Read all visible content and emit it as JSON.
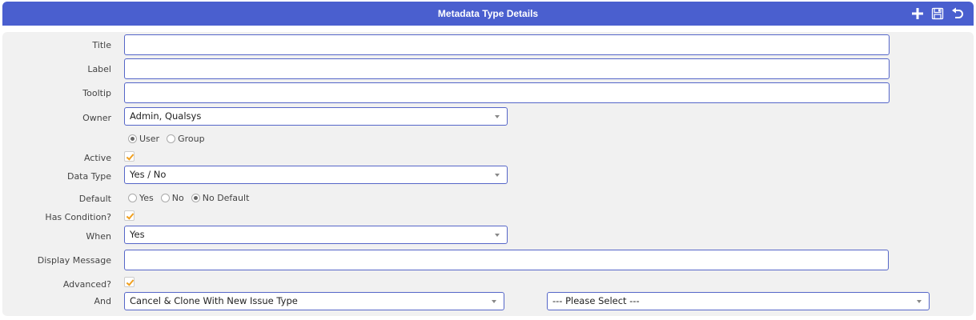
{
  "header": {
    "title": "Metadata Type Details",
    "icons": [
      "add-icon",
      "save-icon",
      "undo-icon"
    ]
  },
  "form": {
    "title": {
      "label": "Title",
      "value": ""
    },
    "label": {
      "label": "Label",
      "value": ""
    },
    "tooltip": {
      "label": "Tooltip",
      "value": ""
    },
    "owner": {
      "label": "Owner",
      "value": "Admin, Qualsys",
      "type_options": [
        {
          "label": "User",
          "selected": true
        },
        {
          "label": "Group",
          "selected": false
        }
      ]
    },
    "active": {
      "label": "Active",
      "checked": true
    },
    "data_type": {
      "label": "Data Type",
      "value": "Yes / No"
    },
    "default": {
      "label": "Default",
      "options": [
        {
          "label": "Yes",
          "selected": false
        },
        {
          "label": "No",
          "selected": false
        },
        {
          "label": "No Default",
          "selected": true
        }
      ]
    },
    "has_condition": {
      "label": "Has Condition?",
      "checked": true
    },
    "when": {
      "label": "When",
      "value": "Yes"
    },
    "display_message": {
      "label": "Display Message",
      "value": ""
    },
    "advanced": {
      "label": "Advanced?",
      "checked": true
    },
    "and": {
      "label": "And",
      "action_value": "Cancel & Clone With New Issue Type",
      "target_value": "--- Please Select ---"
    }
  },
  "colors": {
    "header_bg": "#4a5fcf",
    "panel_bg": "#f1f1f1",
    "field_border": "#5566c8",
    "check_mark": "#f0a020"
  }
}
